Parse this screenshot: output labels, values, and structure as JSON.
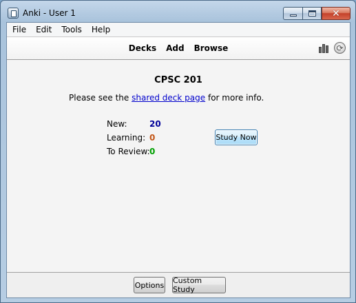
{
  "window": {
    "title": "Anki - User 1"
  },
  "menu": {
    "items": [
      "File",
      "Edit",
      "Tools",
      "Help"
    ]
  },
  "toolbar": {
    "links": [
      "Decks",
      "Add",
      "Browse"
    ],
    "icons": [
      "stats-icon",
      "sync-icon"
    ]
  },
  "deck": {
    "title": "CPSC 201",
    "info_prefix": "Please see the",
    "info_link": "shared deck page",
    "info_suffix": "for more info."
  },
  "counts": {
    "new_label": "New:",
    "new_value": "20",
    "learning_label": "Learning:",
    "learning_value": "0",
    "review_label": "To Review:",
    "review_value": "0"
  },
  "study_button": "Study Now",
  "bottom": {
    "options_label": "Options",
    "custom_study_label": "Custom Study"
  },
  "colors": {
    "new": "#000099",
    "learning": "#c35617",
    "review": "#00a000",
    "link": "#0000cc"
  }
}
